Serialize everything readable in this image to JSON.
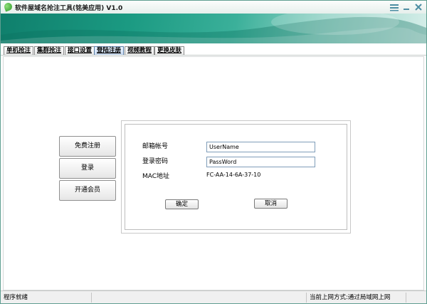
{
  "window": {
    "title": "软件屋域名抢注工具(铭美应用) V1.0",
    "icon": "leaf-icon",
    "controls": [
      "settings-icon",
      "minimize-icon",
      "close-icon"
    ]
  },
  "tabs": [
    {
      "label": "单机抢注",
      "active": false
    },
    {
      "label": "集群抢注",
      "active": false
    },
    {
      "label": "接口设置",
      "active": false
    },
    {
      "label": "登陆注册",
      "active": true
    },
    {
      "label": "视频教程",
      "active": false
    },
    {
      "label": "更换皮肤",
      "active": false
    }
  ],
  "sidebar": {
    "register_label": "免费注册",
    "login_label": "登录",
    "vip_label": "开通会员"
  },
  "form": {
    "email_label": "邮箱帐号",
    "email_value": "UserName",
    "password_label": "登录密码",
    "password_value": "PassWord",
    "mac_label": "MAC地址",
    "mac_value": "FC-AA-14-6A-37-10",
    "confirm_label": "确定",
    "cancel_label": "取消"
  },
  "statusbar": {
    "left_text": "程序就绪",
    "right_text": "当前上网方式:通过局域网上网"
  },
  "colors": {
    "banner_dark": "#0f7f6c",
    "banner_light": "#d6eee9",
    "active_tab": "#c9dcf4",
    "input_border": "#7f9db9"
  }
}
